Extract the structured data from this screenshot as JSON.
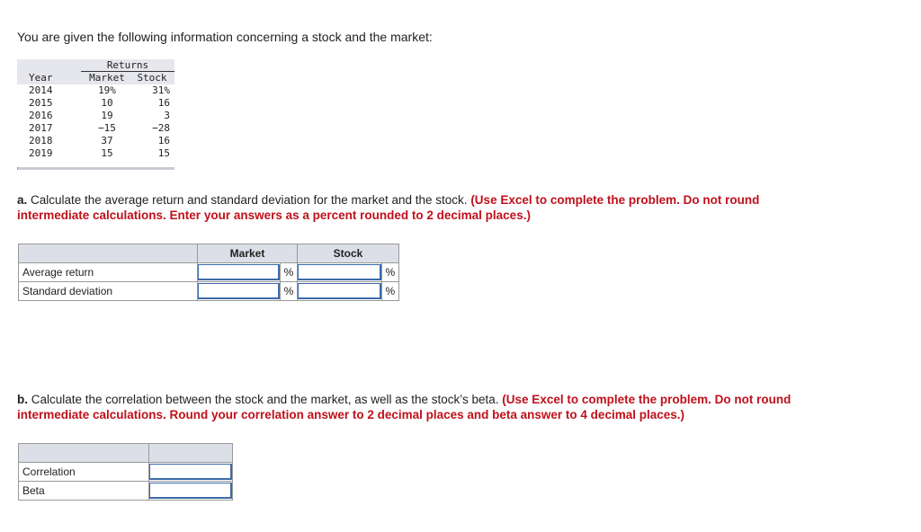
{
  "intro": "You are given the following information concerning a stock and the market:",
  "returns_table": {
    "group_header": "Returns",
    "columns": [
      "Year",
      "Market",
      "Stock"
    ],
    "rows": [
      [
        "2014",
        "19%",
        "31%"
      ],
      [
        "2015",
        "10",
        "16"
      ],
      [
        "2016",
        "19",
        "3"
      ],
      [
        "2017",
        "−15",
        "−28"
      ],
      [
        "2018",
        "37",
        "16"
      ],
      [
        "2019",
        "15",
        "15"
      ]
    ]
  },
  "part_a": {
    "label": "a.",
    "text": " Calculate the average return and standard deviation for the market and the stock. ",
    "instruction": "(Use Excel to complete the problem. Do not round intermediate calculations. Enter your answers as a percent rounded to 2 decimal places.)",
    "table": {
      "headers": [
        "",
        "Market",
        "Stock"
      ],
      "rows": [
        {
          "label": "Average return",
          "market": "",
          "stock": "",
          "unit": "%"
        },
        {
          "label": "Standard deviation",
          "market": "",
          "stock": "",
          "unit": "%"
        }
      ]
    }
  },
  "part_b": {
    "label": "b.",
    "text": " Calculate the correlation between the stock and the market, as well as the stock’s beta. ",
    "instruction": "(Use Excel to complete the problem. Do not round intermediate calculations. Round your correlation answer to 2 decimal places and beta answer to 4 decimal places.)",
    "table": {
      "rows": [
        {
          "label": "Correlation",
          "value": ""
        },
        {
          "label": "Beta",
          "value": ""
        }
      ]
    }
  }
}
